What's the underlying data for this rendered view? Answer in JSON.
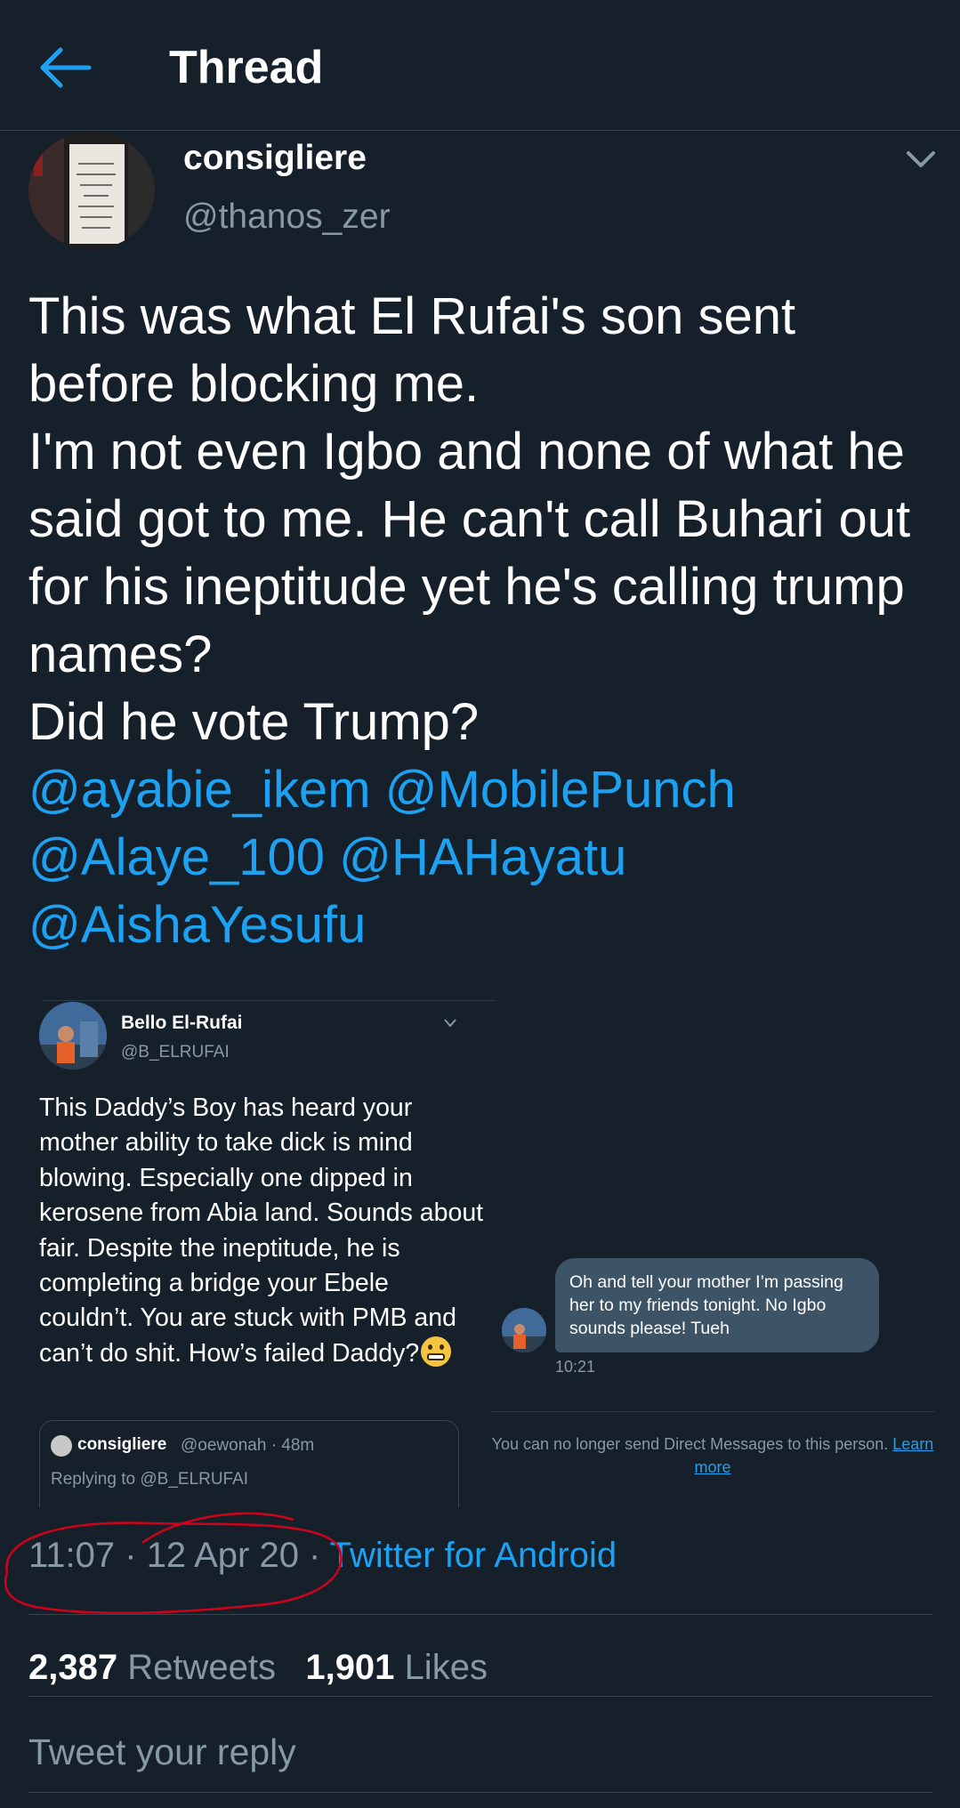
{
  "header": {
    "title": "Thread"
  },
  "tweet": {
    "name": "consigliere",
    "handle": "@thanos_zer",
    "text": "This was what El Rufai's son sent before blocking me.\nI'm not even Igbo and none of what he said got to me. He can't call Buhari out for his ineptitude yet he's calling trump names?\nDid he vote Trump?",
    "mentions": "@ayabie_ikem @MobilePunch @Alaye_100 @HAHayatu @AishaYesufu"
  },
  "embed": {
    "tweet": {
      "name": "Bello El-Rufai",
      "handle": "@B_ELRUFAI",
      "text": "This Daddy’s Boy has heard your mother ability to take dick is mind blowing. Especially one dipped in kerosene from Abia land. Sounds about fair. Despite the ineptitude, he is completing a bridge your Ebele couldn’t. You are stuck with PMB and can’t do shit. How’s failed Daddy?",
      "quote": {
        "name": "consigliere",
        "meta": "@oewonah · 48m",
        "reply": "Replying to @B_ELRUFAI"
      }
    },
    "dm": {
      "message": "Oh and tell your mother I’m passing her to my friends tonight. No Igbo sounds please! Tueh",
      "time": "10:21",
      "notice": "You can no longer send Direct Messages to this person.",
      "learn_more": "Learn more"
    }
  },
  "meta": {
    "time": "11:07",
    "date": "12 Apr 20",
    "source": "Twitter for Android"
  },
  "stats": {
    "retweets_count": "2,387",
    "retweets_label": "Retweets",
    "likes_count": "1,901",
    "likes_label": "Likes"
  },
  "reply": {
    "placeholder": "Tweet your reply"
  },
  "colors": {
    "background": "#15202b",
    "accent": "#1da1f2",
    "muted": "#8899a6",
    "annotation": "#d0021b"
  }
}
